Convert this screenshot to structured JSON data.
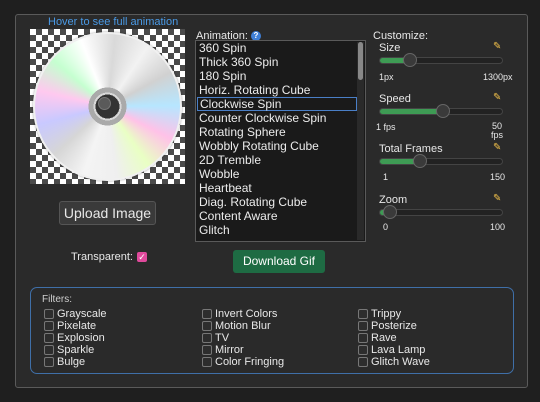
{
  "preview": {
    "hover_note": "Hover to see full animation",
    "upload_label": "Upload Image",
    "transparent_label": "Transparent:"
  },
  "animation": {
    "label": "Animation:",
    "items": [
      "360 Spin",
      "Thick 360 Spin",
      "180 Spin",
      "Horiz. Rotating Cube",
      "Clockwise Spin",
      "Counter Clockwise Spin",
      "Rotating Sphere",
      "Wobbly Rotating Cube",
      "2D Tremble",
      "Wobble",
      "Heartbeat",
      "Diag. Rotating Cube",
      "Content Aware",
      "Glitch"
    ],
    "selected": "Clockwise Spin"
  },
  "download_label": "Download Gif",
  "customize": {
    "title": "Customize:",
    "size": {
      "label": "Size",
      "min": "1px",
      "max": "1300px",
      "value_fraction": 0.25
    },
    "speed": {
      "label": "Speed",
      "min": "1 fps",
      "max": "50\nfps",
      "value_fraction": 0.52
    },
    "frames": {
      "label": "Total Frames",
      "min": "1",
      "max": "150",
      "value_fraction": 0.33
    },
    "zoom": {
      "label": "Zoom",
      "min": "0",
      "max": "100",
      "value_fraction": 0.09
    }
  },
  "filters": {
    "title": "Filters:",
    "col1": [
      "Grayscale",
      "Pixelate",
      "Explosion",
      "Sparkle",
      "Bulge"
    ],
    "col2": [
      "Invert Colors",
      "Motion Blur",
      "TV",
      "Mirror",
      "Color Fringing"
    ],
    "col3": [
      "Trippy",
      "Posterize",
      "Rave",
      "Lava Lamp",
      "Glitch Wave"
    ]
  },
  "colors": {
    "accent_green": "#3e9b54",
    "download_green": "#1e6b43",
    "link_blue": "#4a9ae6",
    "checkbox_pink": "#e04a9c",
    "pencil_yellow": "#f2c14a"
  }
}
